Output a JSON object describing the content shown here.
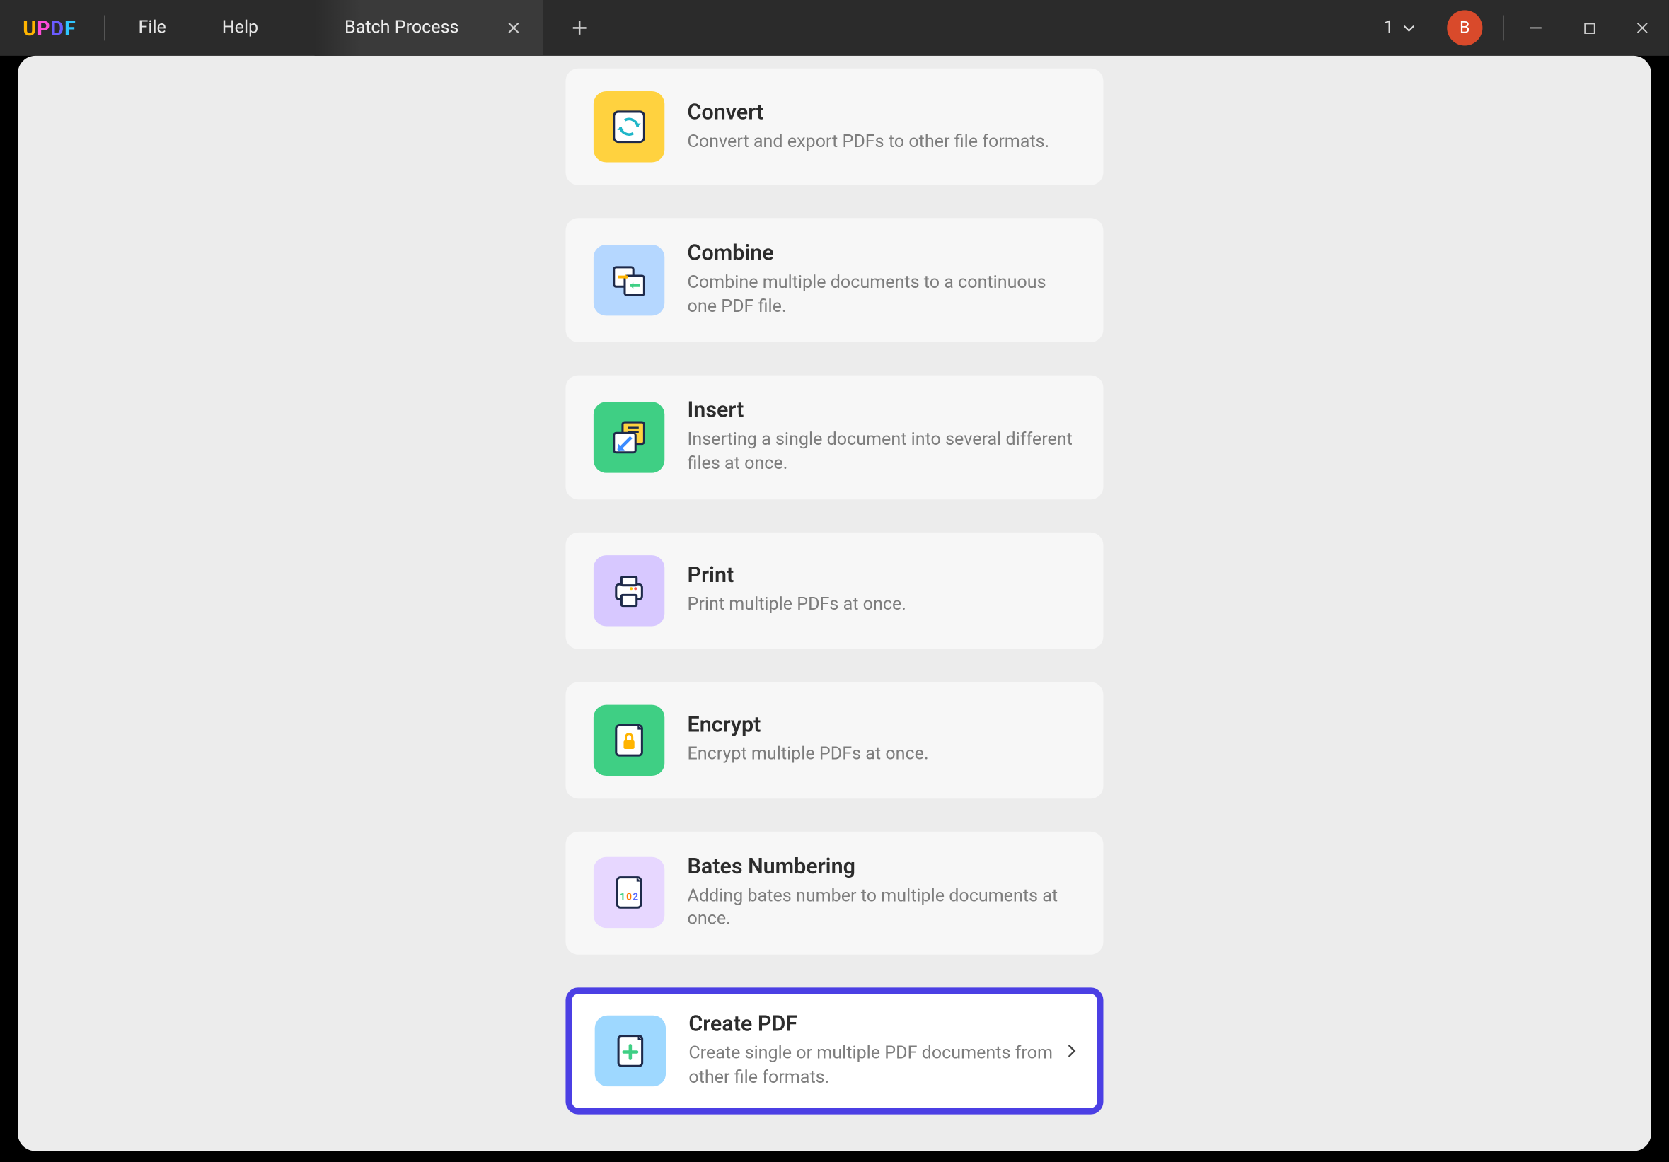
{
  "app": {
    "logo": "UPDF"
  },
  "menu": {
    "file": "File",
    "help": "Help"
  },
  "tab": {
    "title": "Batch Process"
  },
  "header": {
    "count": "1",
    "avatar_initial": "B"
  },
  "cards": [
    {
      "id": "convert",
      "title": "Convert",
      "desc": "Convert and export PDFs to other file formats."
    },
    {
      "id": "combine",
      "title": "Combine",
      "desc": "Combine multiple documents to a continuous one PDF file."
    },
    {
      "id": "insert",
      "title": "Insert",
      "desc": "Inserting a single document into several different files at once."
    },
    {
      "id": "print",
      "title": "Print",
      "desc": "Print multiple PDFs at once."
    },
    {
      "id": "encrypt",
      "title": "Encrypt",
      "desc": "Encrypt multiple PDFs at once."
    },
    {
      "id": "bates",
      "title": "Bates Numbering",
      "desc": "Adding bates number to multiple documents at once."
    },
    {
      "id": "create",
      "title": "Create PDF",
      "desc": "Create single or multiple PDF documents from other file formats.",
      "selected": true
    }
  ]
}
